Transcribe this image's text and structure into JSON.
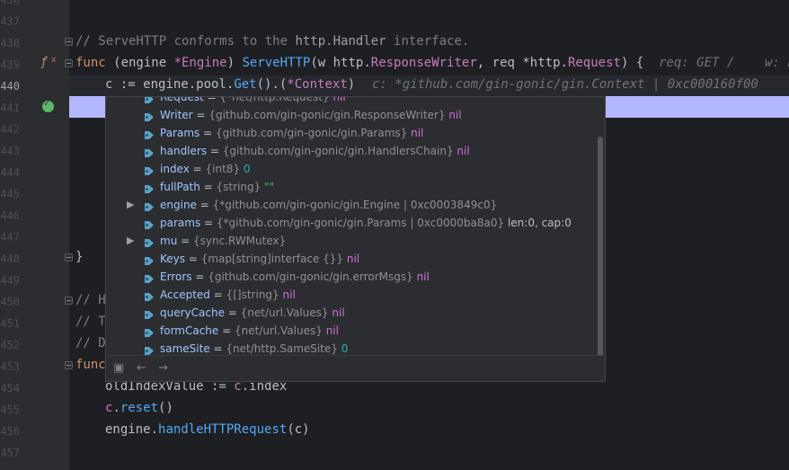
{
  "line_numbers": [
    "436",
    "437",
    "438",
    "439",
    "440",
    "441",
    "442",
    "443",
    "444",
    "445",
    "446",
    "447",
    "448",
    "449",
    "450",
    "451",
    "452",
    "453",
    "454",
    "455",
    "456",
    "457"
  ],
  "code": {
    "comment1_a": "// ServeHTTP ",
    "comment1_b": "conforms to the ",
    "comment1_c": "http.Handler ",
    "comment1_d": "interface.",
    "func_kw": "func",
    "recv_open": " (engine ",
    "recv_type": "*Engine",
    "recv_close": ") ",
    "method": "ServeHTTP",
    "params_a": "(w ",
    "params_b": "http.",
    "params_c": "ResponseWriter",
    "params_d": ", req ",
    "params_e": "*http.",
    "params_f": "Request",
    "params_g": ") {",
    "hint1": "req: GET /    w: ",
    "hint1b": "n",
    "assign_a": "c := ",
    "assign_b": "engine",
    "assign_c": ".pool.",
    "assign_d": "Get",
    "assign_e": "().(",
    "assign_f": "*Context",
    "assign_g": ")",
    "hint2": "c: *github.com/gin-gonic/gin.Context | 0xc000160f00",
    "brace": "}",
    "comment_h": "// H",
    "comment_t": "// T",
    "comment_d": "// D",
    "func2": "func",
    "old_a": "oldIndexValue := ",
    "old_b": "c",
    "old_c": ".index",
    "reset_a": "c",
    "reset_b": ".",
    "reset_c": "reset",
    "reset_d": "()",
    "handle_a": "engine",
    "handle_b": ".",
    "handle_c": "handleHTTPRequest",
    "handle_d": "(c)"
  },
  "debug_popup": {
    "rows": [
      {
        "name": "Request",
        "type": "{*net/http.Request}",
        "value": "nil",
        "vclass": "nil",
        "expandable": false,
        "partial": true
      },
      {
        "name": "Writer",
        "type": "{github.com/gin-gonic/gin.ResponseWriter}",
        "value": "nil",
        "vclass": "nil",
        "expandable": false
      },
      {
        "name": "Params",
        "type": "{github.com/gin-gonic/gin.Params}",
        "value": "nil",
        "vclass": "nil",
        "expandable": false
      },
      {
        "name": "handlers",
        "type": "{github.com/gin-gonic/gin.HandlersChain}",
        "value": "nil",
        "vclass": "nil",
        "expandable": false
      },
      {
        "name": "index",
        "type": "{int8}",
        "value": "0",
        "vclass": "num",
        "expandable": false
      },
      {
        "name": "fullPath",
        "type": "{string}",
        "value": "\"\"",
        "vclass": "str",
        "expandable": false
      },
      {
        "name": "engine",
        "type": "{*github.com/gin-gonic/gin.Engine | 0xc0003849c0}",
        "value": "",
        "vclass": "nil",
        "expandable": true
      },
      {
        "name": "params",
        "type": "{*github.com/gin-gonic/gin.Params | 0xc0000ba8a0}",
        "value": "len:0, cap:0",
        "vclass": "len",
        "expandable": false
      },
      {
        "name": "mu",
        "type": "{sync.RWMutex}",
        "value": "",
        "vclass": "nil",
        "expandable": true
      },
      {
        "name": "Keys",
        "type": "{map[string]interface {}}",
        "value": "nil",
        "vclass": "nil",
        "expandable": false
      },
      {
        "name": "Errors",
        "type": "{github.com/gin-gonic/gin.errorMsgs}",
        "value": "nil",
        "vclass": "nil",
        "expandable": false
      },
      {
        "name": "Accepted",
        "type": "{[]string}",
        "value": "nil",
        "vclass": "nil",
        "expandable": false
      },
      {
        "name": "queryCache",
        "type": "{net/url.Values}",
        "value": "nil",
        "vclass": "nil",
        "expandable": false
      },
      {
        "name": "formCache",
        "type": "{net/url.Values}",
        "value": "nil",
        "vclass": "nil",
        "expandable": false
      },
      {
        "name": "sameSite",
        "type": "{net/http.SameSite}",
        "value": "0",
        "vclass": "num",
        "expandable": false
      }
    ],
    "eq": " = ",
    "toolbar_icons": [
      "pin-icon",
      "back-arrow-icon",
      "forward-arrow-icon"
    ]
  },
  "colors": {
    "editor_bg": "#1e1f22",
    "selection": "#b3b7ff",
    "tag_icon": "#57a3c9"
  }
}
